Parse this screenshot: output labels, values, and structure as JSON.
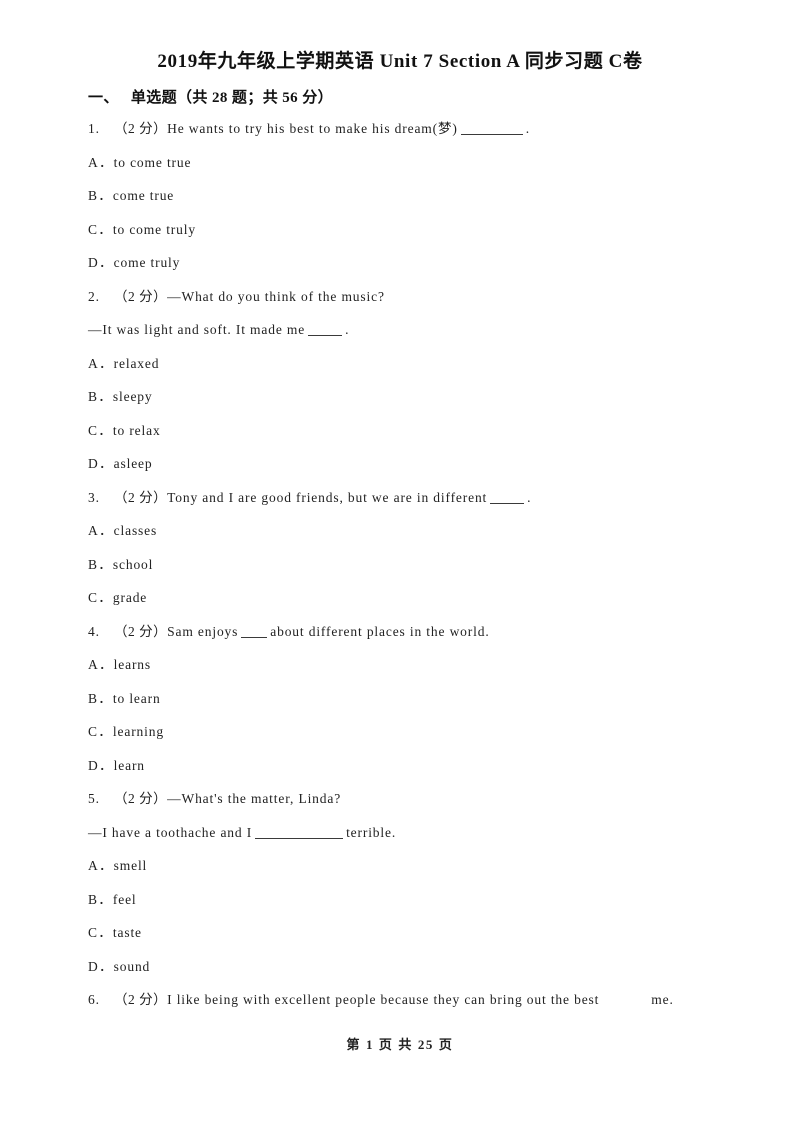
{
  "document": {
    "title": "2019年九年级上学期英语 Unit 7 Section A 同步习题 C卷",
    "footer": "第 1 页 共 25 页"
  },
  "sections": [
    {
      "number": "一、",
      "heading": "单选题（共 28 题；共 56 分）"
    }
  ],
  "questions": [
    {
      "number": "1.",
      "score": "（2 分）",
      "stem_before": "He wants to try his best to make his dream(梦)",
      "blank": "md",
      "stem_after": ".",
      "second_line": null,
      "options": [
        {
          "letter": "A．",
          "text": "to come true"
        },
        {
          "letter": "B．",
          "text": "come true"
        },
        {
          "letter": "C．",
          "text": "to come truly"
        },
        {
          "letter": "D．",
          "text": "come truly"
        }
      ]
    },
    {
      "number": "2.",
      "score": "（2 分）",
      "stem_before": "—What do you think of the music?",
      "blank": null,
      "stem_after": "",
      "second_line_before": "—It was light and soft. It made me",
      "second_line_blank": "sm",
      "second_line_after": ".",
      "options": [
        {
          "letter": "A．",
          "text": "relaxed"
        },
        {
          "letter": "B．",
          "text": "sleepy"
        },
        {
          "letter": "C．",
          "text": "to relax"
        },
        {
          "letter": "D．",
          "text": "asleep"
        }
      ]
    },
    {
      "number": "3.",
      "score": "（2 分）",
      "stem_before": "Tony and I are good friends, but we are in different",
      "blank": "sm",
      "stem_after": ".",
      "second_line": null,
      "options": [
        {
          "letter": "A．",
          "text": "classes"
        },
        {
          "letter": "B．",
          "text": "school"
        },
        {
          "letter": "C．",
          "text": "grade"
        }
      ]
    },
    {
      "number": "4.",
      "score": "（2 分）",
      "stem_before": "Sam enjoys",
      "blank": "xs",
      "stem_after": "about different places in the world.",
      "second_line": null,
      "options": [
        {
          "letter": "A．",
          "text": "learns"
        },
        {
          "letter": "B．",
          "text": "to learn"
        },
        {
          "letter": "C．",
          "text": "learning"
        },
        {
          "letter": "D．",
          "text": "learn"
        }
      ]
    },
    {
      "number": "5.",
      "score": "（2 分）",
      "stem_before": "—What's the matter, Linda?",
      "blank": null,
      "stem_after": "",
      "second_line_before": "—I have a toothache and I",
      "second_line_blank": "lg",
      "second_line_after": "terrible.",
      "options": [
        {
          "letter": "A．",
          "text": "smell"
        },
        {
          "letter": "B．",
          "text": "feel"
        },
        {
          "letter": "C．",
          "text": "taste"
        },
        {
          "letter": "D．",
          "text": "sound"
        }
      ]
    },
    {
      "number": "6.",
      "score": "（2 分）",
      "stem_before": "I like being with excellent people because they can bring out the best",
      "blank": "invisible",
      "stem_after": "me.",
      "second_line": null,
      "options": []
    }
  ]
}
